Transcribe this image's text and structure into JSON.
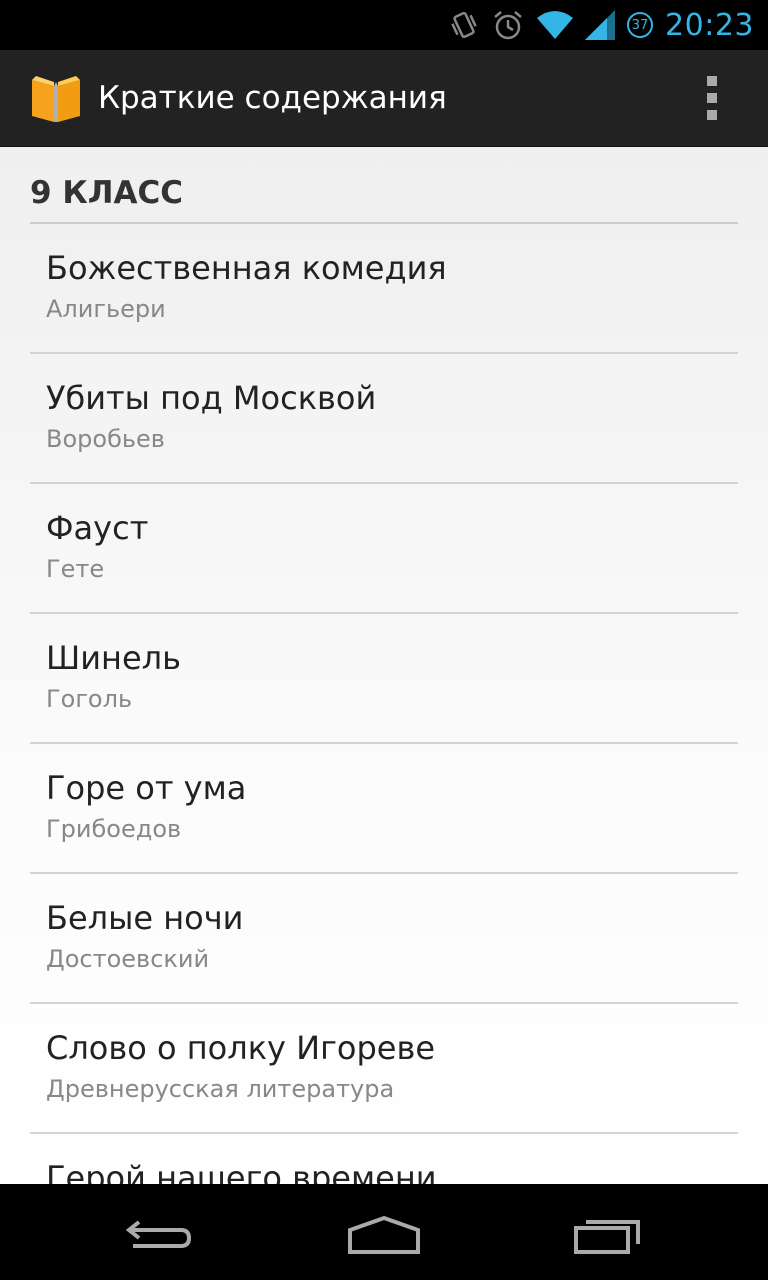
{
  "status_bar": {
    "time": "20:23",
    "battery_level": "37",
    "icons": [
      "vibrate-icon",
      "alarm-icon",
      "wifi-icon",
      "signal-icon",
      "battery-icon"
    ]
  },
  "action_bar": {
    "title": "Краткие содержания",
    "app_icon": "book-icon",
    "menu_icon": "overflow-menu-icon"
  },
  "section": {
    "header": "9 КЛАСС"
  },
  "items": [
    {
      "title": "Божественная комедия",
      "author": "Алигьери"
    },
    {
      "title": "Убиты под Москвой",
      "author": "Воробьев"
    },
    {
      "title": "Фауст",
      "author": "Гете"
    },
    {
      "title": "Шинель",
      "author": "Гоголь"
    },
    {
      "title": "Горе от ума",
      "author": "Грибоедов"
    },
    {
      "title": "Белые ночи",
      "author": "Достоевский"
    },
    {
      "title": "Слово о полку Игореве",
      "author": "Древнерусская литература"
    },
    {
      "title": "Герой нашего времени",
      "author": ""
    }
  ],
  "nav_bar": {
    "icons": [
      "back-icon",
      "home-icon",
      "recents-icon"
    ]
  },
  "colors": {
    "accent": "#33b5e5",
    "action_bar": "#222222",
    "background": "#efefef"
  }
}
